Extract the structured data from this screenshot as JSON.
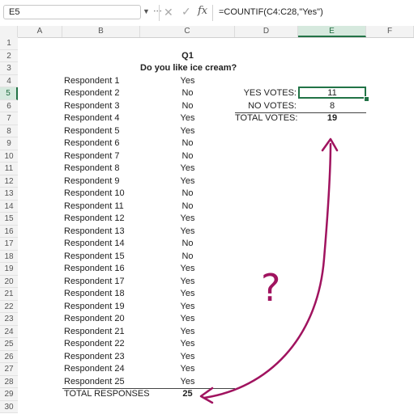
{
  "formula_bar": {
    "name_box": "E5",
    "formula": "=COUNTIF(C4:C28,\"Yes\")",
    "fx_label": "fx"
  },
  "columns": [
    "A",
    "B",
    "C",
    "D",
    "E",
    "F"
  ],
  "rows": [
    "1",
    "2",
    "3",
    "4",
    "5",
    "6",
    "7",
    "8",
    "9",
    "10",
    "11",
    "12",
    "13",
    "14",
    "15",
    "16",
    "17",
    "18",
    "19",
    "20",
    "21",
    "22",
    "23",
    "24",
    "25",
    "26",
    "27",
    "28",
    "29",
    "30"
  ],
  "sheet": {
    "q_title": "Q1",
    "q_text": "Do you like ice cream?",
    "respondents": [
      {
        "name": "Respondent 1",
        "answer": "Yes"
      },
      {
        "name": "Respondent 2",
        "answer": "No"
      },
      {
        "name": "Respondent 3",
        "answer": "No"
      },
      {
        "name": "Respondent 4",
        "answer": "Yes"
      },
      {
        "name": "Respondent 5",
        "answer": "Yes"
      },
      {
        "name": "Respondent 6",
        "answer": "No"
      },
      {
        "name": "Respondent 7",
        "answer": "No"
      },
      {
        "name": "Respondent 8",
        "answer": "Yes"
      },
      {
        "name": "Respondent 9",
        "answer": "Yes"
      },
      {
        "name": "Respondent 10",
        "answer": "No"
      },
      {
        "name": "Respondent 11",
        "answer": "No"
      },
      {
        "name": "Respondent 12",
        "answer": "Yes"
      },
      {
        "name": "Respondent 13",
        "answer": "Yes"
      },
      {
        "name": "Respondent 14",
        "answer": "No"
      },
      {
        "name": "Respondent 15",
        "answer": "No"
      },
      {
        "name": "Respondent 16",
        "answer": "Yes"
      },
      {
        "name": "Respondent 17",
        "answer": "Yes"
      },
      {
        "name": "Respondent 18",
        "answer": "Yes"
      },
      {
        "name": "Respondent 19",
        "answer": "Yes"
      },
      {
        "name": "Respondent 20",
        "answer": "Yes"
      },
      {
        "name": "Respondent 21",
        "answer": "Yes"
      },
      {
        "name": "Respondent 22",
        "answer": "Yes"
      },
      {
        "name": "Respondent 23",
        "answer": "Yes"
      },
      {
        "name": "Respondent 24",
        "answer": "Yes"
      },
      {
        "name": "Respondent 25",
        "answer": "Yes"
      }
    ],
    "total_label": "TOTAL RESPONSES",
    "total_value": "25",
    "yes_label": "YES VOTES:",
    "yes_value": "11",
    "no_label": "NO VOTES:",
    "no_value": "8",
    "total_votes_label": "TOTAL VOTES:",
    "total_votes_value": "19"
  },
  "annotation": {
    "text": "?",
    "color": "#a0135f"
  },
  "colors": {
    "selection": "#217346",
    "header_bg": "#f3f3f3"
  }
}
